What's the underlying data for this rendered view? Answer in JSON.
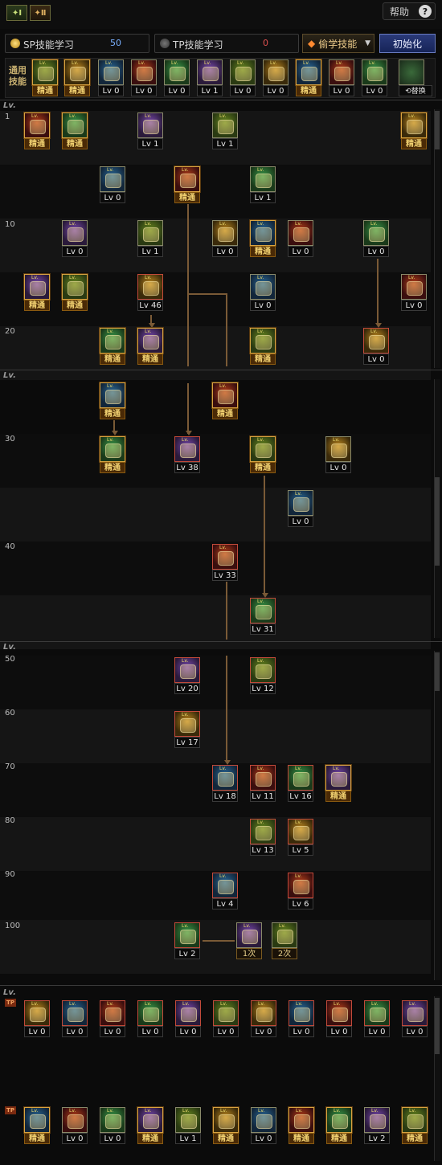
{
  "header": {
    "tab1_label": "✦Ⅰ",
    "tab2_label": "✦Ⅱ",
    "help_label": "帮助",
    "help_icon": "?"
  },
  "points": {
    "sp_label": "SP技能学习",
    "sp_value": "50",
    "tp_label": "TP技能学习",
    "tp_value": "0",
    "steal_label": "偷学技能",
    "init_label": "初始化"
  },
  "common": {
    "label_line1": "通用",
    "label_line2": "技能",
    "swap_label": "⟲替换",
    "skills": [
      {
        "icon": "slash-skill-icon",
        "caption": "精通",
        "style": "mastery"
      },
      {
        "icon": "kick-skill-icon",
        "caption": "精通",
        "style": "mastery"
      },
      {
        "icon": "dash-skill-icon",
        "caption": "Lv 0",
        "style": "lv"
      },
      {
        "icon": "wings-skill-icon",
        "caption": "Lv 0",
        "style": "lv"
      },
      {
        "icon": "target-skill-icon",
        "caption": "Lv 0",
        "style": "lv"
      },
      {
        "icon": "crosshair-skill-icon",
        "caption": "Lv 1",
        "style": "lv"
      },
      {
        "icon": "stance-skill-icon",
        "caption": "Lv 0",
        "style": "lv"
      },
      {
        "icon": "stance2-skill-icon",
        "caption": "Lv 0",
        "style": "lv"
      },
      {
        "icon": "eye-skill-icon",
        "caption": "精通",
        "style": "mastery"
      },
      {
        "icon": "body-skill-icon",
        "caption": "Lv 0",
        "style": "lv"
      },
      {
        "icon": "claw-skill-icon",
        "caption": "Lv 0",
        "style": "lv"
      }
    ]
  },
  "levels": {
    "header": "Lv.",
    "rows": [
      "1",
      "10",
      "20",
      "30",
      "40",
      "50",
      "60",
      "70",
      "80",
      "90",
      "100"
    ]
  },
  "tree": [
    {
      "icon": "ground-skill-icon",
      "caption": "精通",
      "style": "mastery"
    },
    {
      "icon": "grab-skill-icon",
      "caption": "精通",
      "style": "mastery"
    },
    {
      "icon": "strike-skill-icon",
      "caption": "Lv 1",
      "style": "lv"
    },
    {
      "icon": "sweep-skill-icon",
      "caption": "Lv 1",
      "style": "lv"
    },
    {
      "icon": "burst-skill-icon",
      "caption": "精通",
      "style": "mastery"
    },
    {
      "icon": "uppercut-skill-icon",
      "caption": "Lv 0",
      "style": "lv"
    },
    {
      "icon": "muscle-skill-icon",
      "caption": "精通",
      "style": "mastery"
    },
    {
      "icon": "flash-skill-icon",
      "caption": "Lv 1",
      "style": "lv"
    },
    {
      "icon": "shock-skill-icon",
      "caption": "Lv 0",
      "style": "lv"
    },
    {
      "icon": "throw-skill-icon",
      "caption": "Lv 1",
      "style": "lv"
    },
    {
      "icon": "armor-skill-icon",
      "caption": "Lv 0",
      "style": "lv"
    },
    {
      "icon": "run-skill-icon",
      "caption": "精通",
      "style": "mastery"
    },
    {
      "icon": "leap-skill-icon",
      "caption": "Lv 0",
      "style": "lv"
    },
    {
      "icon": "spin-skill-icon",
      "caption": "Lv 0",
      "style": "lv"
    },
    {
      "icon": "buff-skill-icon",
      "caption": "精通",
      "style": "mastery"
    },
    {
      "icon": "spark-skill-icon",
      "caption": "精通",
      "style": "mastery"
    },
    {
      "icon": "fire-skill-icon",
      "caption": "Lv 46",
      "style": "lv"
    },
    {
      "icon": "hop-skill-icon",
      "caption": "Lv 0",
      "style": "lv"
    },
    {
      "icon": "crescent-skill-icon",
      "caption": "Lv 0",
      "style": "lv"
    },
    {
      "icon": "toggle-skill-icon",
      "caption": "精通",
      "style": "mastery"
    },
    {
      "icon": "leaf-skill-icon",
      "caption": "精通",
      "style": "mastery"
    },
    {
      "icon": "ice-skill-icon",
      "caption": "精通",
      "style": "mastery"
    },
    {
      "icon": "whirl-skill-icon",
      "caption": "Lv 0",
      "style": "lv"
    },
    {
      "icon": "smash-skill-icon",
      "caption": "精通",
      "style": "mastery"
    },
    {
      "icon": "bolt-skill-icon",
      "caption": "精通",
      "style": "mastery"
    },
    {
      "icon": "combo-skill-icon",
      "caption": "精通",
      "style": "mastery"
    },
    {
      "icon": "rage-skill-icon",
      "caption": "Lv 38",
      "style": "lv"
    },
    {
      "icon": "cannon-skill-icon",
      "caption": "精通",
      "style": "mastery"
    },
    {
      "icon": "tornado-skill-icon",
      "caption": "Lv 0",
      "style": "lv"
    },
    {
      "icon": "aura-skill-icon",
      "caption": "Lv 0",
      "style": "lv"
    },
    {
      "icon": "meteor-skill-icon",
      "caption": "Lv 33",
      "style": "lv"
    },
    {
      "icon": "blaze-skill-icon",
      "caption": "Lv 31",
      "style": "lv"
    },
    {
      "icon": "quake-skill-icon",
      "caption": "Lv 20",
      "style": "lv"
    },
    {
      "icon": "inferno-skill-icon",
      "caption": "Lv 12",
      "style": "lv"
    },
    {
      "icon": "comet-skill-icon",
      "caption": "Lv 17",
      "style": "lv"
    },
    {
      "icon": "titan-skill-icon",
      "caption": "Lv 18",
      "style": "lv"
    },
    {
      "icon": "shadow-skill-icon",
      "caption": "Lv 11",
      "style": "lv"
    },
    {
      "icon": "demon-skill-icon",
      "caption": "Lv 16",
      "style": "lv"
    },
    {
      "icon": "orb-skill-icon",
      "caption": "精通",
      "style": "mastery"
    },
    {
      "icon": "vortex-skill-icon",
      "caption": "Lv 13",
      "style": "lv"
    },
    {
      "icon": "avatar-skill-icon",
      "caption": "Lv 5",
      "style": "lv"
    },
    {
      "icon": "beast-skill-icon",
      "caption": "Lv 4",
      "style": "lv"
    },
    {
      "icon": "ultimate-skill-icon",
      "caption": "Lv 6",
      "style": "lv"
    },
    {
      "icon": "awakening-skill-icon",
      "caption": "Lv 2",
      "style": "lv"
    },
    {
      "icon": "awaken-first-icon",
      "caption": "1次",
      "style": "times"
    },
    {
      "icon": "awaken-second-icon",
      "caption": "2次",
      "style": "times"
    }
  ],
  "tp": {
    "header": "Lv.",
    "badge": "TP",
    "row1": [
      "Lv 0",
      "Lv 0",
      "Lv 0",
      "Lv 0",
      "Lv 0",
      "Lv 0",
      "Lv 0",
      "Lv 0",
      "Lv 0",
      "Lv 0",
      "Lv 0"
    ],
    "row2": [
      {
        "caption": "精通",
        "style": "mastery"
      },
      {
        "caption": "Lv 0",
        "style": "lv"
      },
      {
        "caption": "Lv 0",
        "style": "lv"
      },
      {
        "caption": "精通",
        "style": "mastery"
      },
      {
        "caption": "Lv 1",
        "style": "lv"
      },
      {
        "caption": "精通",
        "style": "mastery"
      },
      {
        "caption": "Lv 0",
        "style": "lv"
      },
      {
        "caption": "精通",
        "style": "mastery"
      },
      {
        "caption": "精通",
        "style": "mastery"
      },
      {
        "caption": "Lv 2",
        "style": "lv"
      },
      {
        "caption": "精通",
        "style": "mastery"
      }
    ]
  },
  "colors": {
    "accent_gold": "#d9a441",
    "sp_coin": "#e8c040",
    "tp_coin": "#555555",
    "init_button": "#2a3a78",
    "line": "#7a5a36"
  }
}
